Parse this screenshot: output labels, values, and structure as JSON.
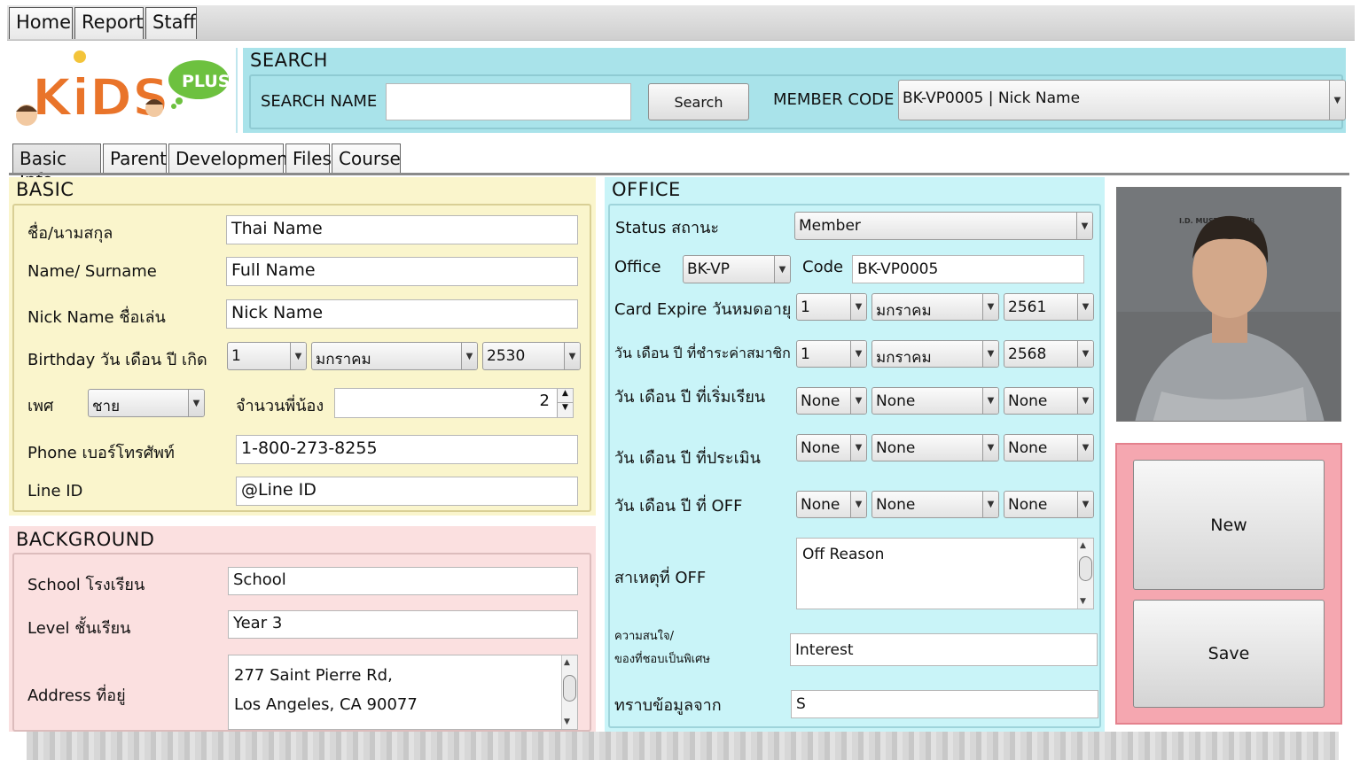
{
  "menu": {
    "home": "Home",
    "report": "Report",
    "staff": "Staff"
  },
  "logo": {
    "kids": "KiDS",
    "plus": "PLUS"
  },
  "search": {
    "title": "SEARCH",
    "name_label": "SEARCH NAME",
    "name_value": "",
    "button": "Search",
    "member_code_label": "MEMBER CODE",
    "member_code_value": "BK-VP0005 | Nick Name"
  },
  "tabs": [
    "Basic Info",
    "Parent",
    "Development",
    "Files",
    "Course"
  ],
  "basic": {
    "title": "BASIC",
    "thai_name_label": "ชื่อ/นามสกุล",
    "thai_name_value": "Thai Name",
    "name_label": "Name/ Surname",
    "name_value": "Full Name",
    "nick_label": "Nick Name ชื่อเล่น",
    "nick_value": "Nick Name",
    "birthday_label": "Birthday วัน เดือน ปี เกิด",
    "birthday_day": "1",
    "birthday_month": "มกราคม",
    "birthday_year": "2530",
    "gender_label": "เพศ",
    "gender_value": "ชาย",
    "siblings_label": "จำนวนพี่น้อง",
    "siblings_value": "2",
    "phone_label": "Phone เบอร์โทรศัพท์",
    "phone_value": "1-800-273-8255",
    "line_label": "Line ID",
    "line_value": "@Line ID"
  },
  "background": {
    "title": "BACKGROUND",
    "school_label": "School โรงเรียน",
    "school_value": "School",
    "level_label": "Level ชั้นเรียน",
    "level_value": "Year 3",
    "address_label": "Address ที่อยู่",
    "address_line1": "277 Saint Pierre Rd,",
    "address_line2": "Los Angeles, CA 90077"
  },
  "office": {
    "title": "OFFICE",
    "status_label": "Status สถานะ",
    "status_value": "Member",
    "office_label": "Office",
    "office_value": "BK-VP",
    "code_label": "Code",
    "code_value": "BK-VP0005",
    "card_expire_label": "Card Expire วันหมดอายุ",
    "card_expire": {
      "day": "1",
      "month": "มกราคม",
      "year": "2561"
    },
    "fee_date_label": "วัน เดือน ปี ที่ชำระค่าสมาชิก",
    "fee_date": {
      "day": "1",
      "month": "มกราคม",
      "year": "2568"
    },
    "start_date_label": "วัน เดือน ปี ที่เริ่มเรียน",
    "start_date": {
      "day": "None",
      "month": "None",
      "year": "None"
    },
    "eval_date_label": "วัน เดือน ปี ที่ประเมิน",
    "eval_date": {
      "day": "None",
      "month": "None",
      "year": "None"
    },
    "off_date_label": "วัน เดือน ปี ที่ OFF",
    "off_date": {
      "day": "None",
      "month": "None",
      "year": "None"
    },
    "off_reason_label": "สาเหตุที่ OFF",
    "off_reason_value": "Off Reason",
    "interest_label_1": "ความสนใจ/",
    "interest_label_2": "ของที่ชอบเป็นพิเศษ",
    "interest_value": "Interest",
    "source_label": "ทราบข้อมูลจาก",
    "source_value": "S"
  },
  "photo": {
    "caption": "I.D. MUST BE VISIB"
  },
  "actions": {
    "new": "New",
    "save": "Save"
  }
}
